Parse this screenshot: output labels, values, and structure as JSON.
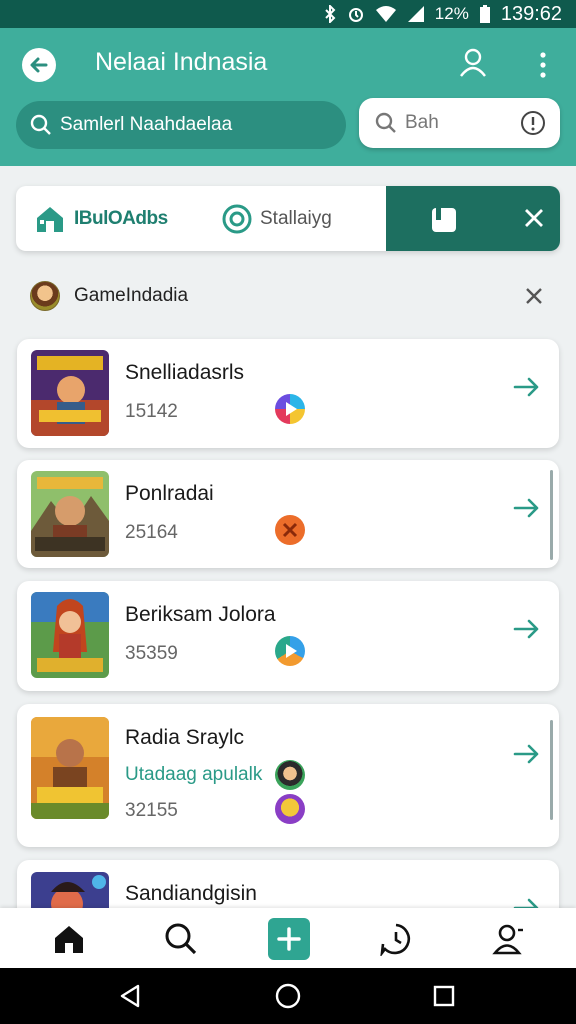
{
  "status_bar": {
    "battery": "12%",
    "time": "139:62",
    "icons": [
      "bluetooth-icon",
      "alarm-icon",
      "wifi-icon",
      "signal-icon",
      "battery-icon"
    ]
  },
  "header": {
    "title": "Nelaai Indnasia",
    "search_placeholder": "Samlerl Naahdaelaa",
    "secondary_search_placeholder": "Bah"
  },
  "tabs": [
    {
      "label": "IBulOAdbs",
      "icon": "store-icon"
    },
    {
      "label": "Stallaiyg",
      "icon": "target-icon"
    },
    {
      "label": "",
      "icon": "door-icon",
      "active": true
    }
  ],
  "section": {
    "title": "GameIndadia"
  },
  "games": [
    {
      "name": "Snelliadasrls",
      "count": "15142",
      "platforms": [
        "play-store-icon"
      ]
    },
    {
      "name": "Ponlradai",
      "count": "25164",
      "platforms": [
        "orange-x-icon"
      ]
    },
    {
      "name": "Beriksam Jolora",
      "count": "35359",
      "platforms": [
        "play-store-icon"
      ]
    },
    {
      "name": "Radia Sraylc",
      "subtitle": "Utadaag apulalk",
      "count": "32155",
      "platforms": [
        "avatar-green-icon",
        "avatar-purple-icon"
      ]
    },
    {
      "name": "Sandiandgisin"
    }
  ],
  "colors": {
    "header": "#3fae9c",
    "status_bar": "#0f5a4d",
    "accent": "#1d6f60",
    "link": "#2a9a87"
  },
  "bottom_nav": [
    "home-icon",
    "search-icon",
    "add-icon",
    "history-icon",
    "profile-icon"
  ],
  "system_nav": [
    "back-icon",
    "home-circle-icon",
    "recents-icon"
  ]
}
